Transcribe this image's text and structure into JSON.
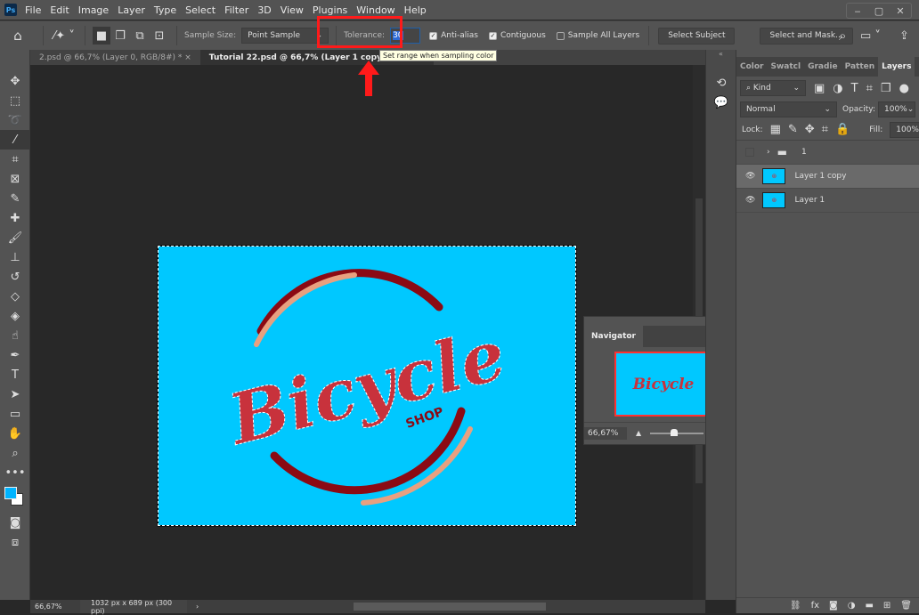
{
  "app": {
    "logo": "Ps"
  },
  "menu": [
    "File",
    "Edit",
    "Image",
    "Layer",
    "Type",
    "Select",
    "Filter",
    "3D",
    "View",
    "Plugins",
    "Window",
    "Help"
  ],
  "window_controls": {
    "minimize": "‒",
    "maximize": "▢",
    "close": "✕"
  },
  "options": {
    "sample_size_label": "Sample Size:",
    "sample_size_value": "Point Sample",
    "tolerance_label": "Tolerance:",
    "tolerance_value": "30",
    "anti_alias": "Anti-alias",
    "anti_alias_checked": true,
    "contiguous": "Contiguous",
    "contiguous_checked": true,
    "sample_all_layers": "Sample All Layers",
    "sample_all_checked": false,
    "select_subject": "Select Subject",
    "select_and_mask": "Select and Mask..."
  },
  "tooltip": "Set range when sampling color",
  "tabs": [
    {
      "label": "2.psd @ 66,7% (Layer 0, RGB/8#) *",
      "close": "×"
    },
    {
      "label": "Tutorial 22.psd @ 66,7% (Layer 1 copy, RGB/8#)"
    }
  ],
  "artwork": {
    "title": "Bicycle",
    "subtitle": "SHOP",
    "background": "#00c8ff"
  },
  "navigator": {
    "title": "Navigator",
    "zoom": "66,67%",
    "zoom_slider_fraction": 0.45
  },
  "status": {
    "zoom": "66,67%",
    "doc_info": "1032 px x 689 px (300 ppi)"
  },
  "panel": {
    "tabs": [
      "Color",
      "Swatcl",
      "Gradie",
      "Patten",
      "Layers"
    ],
    "active_tab": "Layers",
    "filter_kind": "Kind",
    "blend_mode": "Normal",
    "opacity_label": "Opacity:",
    "opacity_value": "100%",
    "lock_label": "Lock:",
    "fill_label": "Fill:",
    "fill_value": "100%",
    "layers": [
      {
        "name": "1",
        "type": "group",
        "visible": false
      },
      {
        "name": "Layer 1 copy",
        "visible": true,
        "selected": true
      },
      {
        "name": "Layer 1",
        "visible": true,
        "selected": false
      }
    ]
  },
  "colors": {
    "accent_red": "#ff1a1a",
    "foreground": "#00b4ff",
    "background": "#ffffff"
  }
}
